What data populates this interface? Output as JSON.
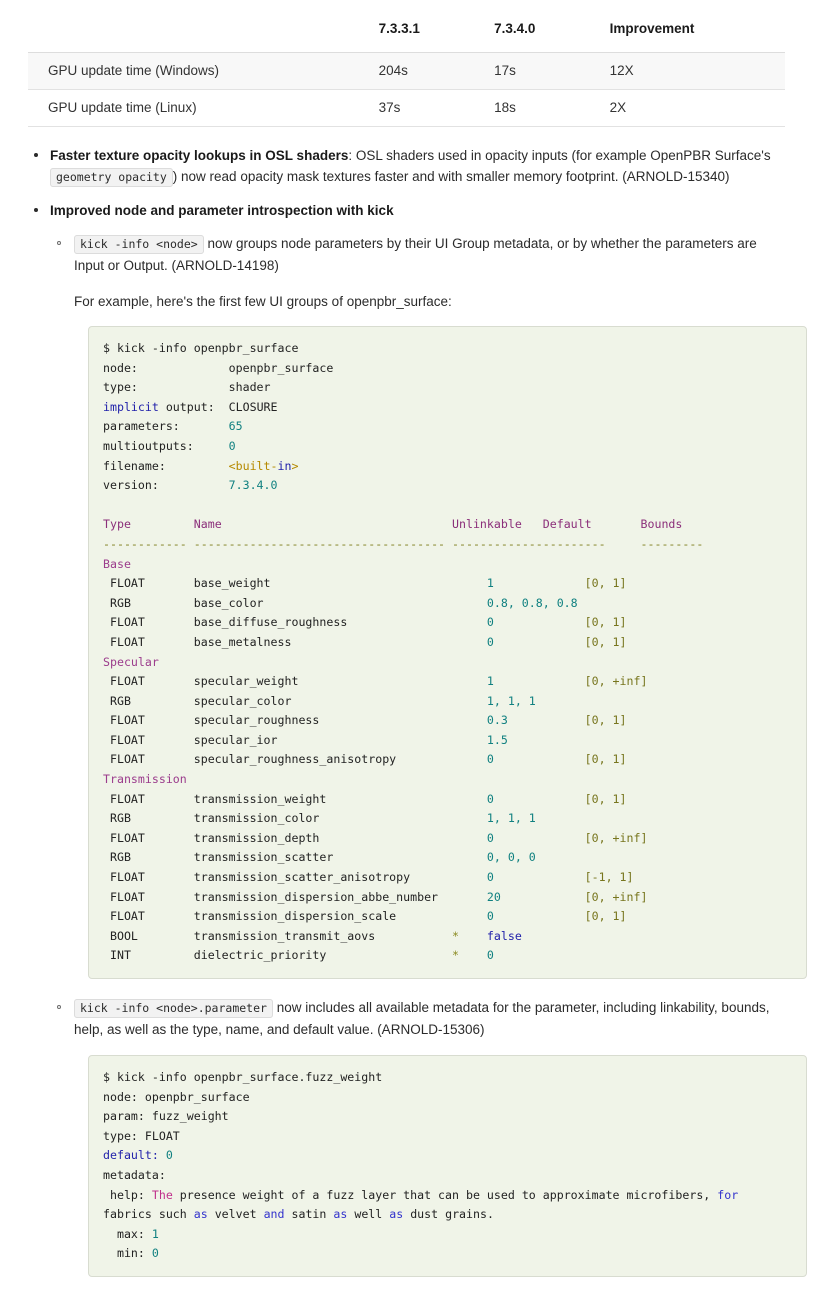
{
  "perf_table": {
    "headers": [
      "",
      "7.3.3.1",
      "7.3.4.0",
      "Improvement"
    ],
    "rows": [
      {
        "label": "GPU update time (Windows)",
        "v1": "204s",
        "v2": "17s",
        "improvement": "12X"
      },
      {
        "label": "GPU update time (Linux)",
        "v1": "37s",
        "v2": "18s",
        "improvement": "2X"
      }
    ]
  },
  "bullets": {
    "item1": {
      "title": "Faster texture opacity lookups in OSL shaders",
      "text_a": ": OSL shaders used in opacity inputs (for example OpenPBR Surface's ",
      "code": "geometry opacity",
      "text_b": ") now read opacity mask textures faster and with smaller memory footprint. (ARNOLD-15340)"
    },
    "item2": {
      "title": "Improved node and parameter introspection with kick",
      "sub1": {
        "code": "kick -info <node>",
        "text": " now groups node parameters by their UI Group metadata, or by whether the parameters are Input or Output. (ARNOLD-14198)",
        "example_intro": "For example, here's the first few UI groups of openpbr_surface:"
      },
      "sub2": {
        "code": "kick -info <node>.parameter",
        "text": " now includes all available metadata for the parameter, including linkability, bounds, help, as well as the type, name, and default value. (ARNOLD-15306)"
      }
    }
  },
  "code_block_1": {
    "command": "$ kick -info openpbr_surface",
    "info_rows": [
      {
        "key": "node:",
        "value": "openpbr_surface",
        "value_kind": "plain"
      },
      {
        "key": "type:",
        "value": "shader",
        "value_kind": "plain"
      },
      {
        "key": "implicit output:",
        "value": "CLOSURE",
        "value_kind": "plain",
        "key_kw": "implicit"
      },
      {
        "key": "parameters:",
        "value": "65",
        "value_kind": "num"
      },
      {
        "key": "multioutputs:",
        "value": "0",
        "value_kind": "num"
      },
      {
        "key": "filename:",
        "value": "<built-in>",
        "value_kind": "builtin"
      },
      {
        "key": "version:",
        "value": "7.3.4.0",
        "value_kind": "num"
      }
    ],
    "table_headers": [
      "Type",
      "Name",
      "Unlinkable",
      "Default",
      "Bounds"
    ],
    "dash_rule": [
      "------------",
      "------------------------------------",
      "-------------",
      "---------"
    ],
    "groups": [
      {
        "name": "Base",
        "params": [
          {
            "type": "FLOAT",
            "name": "base_weight",
            "unlinkable": "",
            "default": "1",
            "default_kind": "num",
            "bounds": "[0, 1]"
          },
          {
            "type": "RGB",
            "name": "base_color",
            "unlinkable": "",
            "default": "0.8, 0.8, 0.8",
            "default_kind": "num",
            "bounds": ""
          },
          {
            "type": "FLOAT",
            "name": "base_diffuse_roughness",
            "unlinkable": "",
            "default": "0",
            "default_kind": "num",
            "bounds": "[0, 1]"
          },
          {
            "type": "FLOAT",
            "name": "base_metalness",
            "unlinkable": "",
            "default": "0",
            "default_kind": "num",
            "bounds": "[0, 1]"
          }
        ]
      },
      {
        "name": "Specular",
        "params": [
          {
            "type": "FLOAT",
            "name": "specular_weight",
            "unlinkable": "",
            "default": "1",
            "default_kind": "num",
            "bounds": "[0, +inf]"
          },
          {
            "type": "RGB",
            "name": "specular_color",
            "unlinkable": "",
            "default": "1, 1, 1",
            "default_kind": "num",
            "bounds": ""
          },
          {
            "type": "FLOAT",
            "name": "specular_roughness",
            "unlinkable": "",
            "default": "0.3",
            "default_kind": "num",
            "bounds": "[0, 1]"
          },
          {
            "type": "FLOAT",
            "name": "specular_ior",
            "unlinkable": "",
            "default": "1.5",
            "default_kind": "num",
            "bounds": ""
          },
          {
            "type": "FLOAT",
            "name": "specular_roughness_anisotropy",
            "unlinkable": "",
            "default": "0",
            "default_kind": "num",
            "bounds": "[0, 1]"
          }
        ]
      },
      {
        "name": "Transmission",
        "params": [
          {
            "type": "FLOAT",
            "name": "transmission_weight",
            "unlinkable": "",
            "default": "0",
            "default_kind": "num",
            "bounds": "[0, 1]"
          },
          {
            "type": "RGB",
            "name": "transmission_color",
            "unlinkable": "",
            "default": "1, 1, 1",
            "default_kind": "num",
            "bounds": ""
          },
          {
            "type": "FLOAT",
            "name": "transmission_depth",
            "unlinkable": "",
            "default": "0",
            "default_kind": "num",
            "bounds": "[0, +inf]"
          },
          {
            "type": "RGB",
            "name": "transmission_scatter",
            "unlinkable": "",
            "default": "0, 0, 0",
            "default_kind": "num",
            "bounds": ""
          },
          {
            "type": "FLOAT",
            "name": "transmission_scatter_anisotropy",
            "unlinkable": "",
            "default": "0",
            "default_kind": "num",
            "bounds": "[-1, 1]"
          },
          {
            "type": "FLOAT",
            "name": "transmission_dispersion_abbe_number",
            "unlinkable": "",
            "default": "20",
            "default_kind": "num",
            "bounds": "[0, +inf]"
          },
          {
            "type": "FLOAT",
            "name": "transmission_dispersion_scale",
            "unlinkable": "",
            "default": "0",
            "default_kind": "num",
            "bounds": "[0, 1]"
          },
          {
            "type": "BOOL",
            "name": "transmission_transmit_aovs",
            "unlinkable": "*",
            "default": "false",
            "default_kind": "kw",
            "bounds": ""
          },
          {
            "type": "INT",
            "name": "dielectric_priority",
            "unlinkable": "*",
            "default": "0",
            "default_kind": "num",
            "bounds": ""
          }
        ]
      }
    ]
  },
  "code_block_2": {
    "command": "$ kick -info openpbr_surface.fuzz_weight",
    "lines": [
      {
        "key": "node:",
        "key_kind": "plain",
        "value": " openpbr_surface"
      },
      {
        "key": "param:",
        "key_kind": "plain",
        "value": " fuzz_weight"
      },
      {
        "key": "type:",
        "key_kind": "plain",
        "value": " FLOAT"
      },
      {
        "key": "default:",
        "key_kind": "kw",
        "value": " 0",
        "value_kind": "num"
      },
      {
        "key": "metadata:",
        "key_kind": "plain",
        "value": ""
      }
    ],
    "help_label": " help:",
    "help_text_parts": [
      {
        "t": " The",
        "c": "magenta"
      },
      {
        "t": " presence weight of a fuzz layer that can be used to approximate microfibers,",
        "c": "plain"
      },
      {
        "t": " for",
        "c": "kw"
      },
      {
        "t": " fabrics such",
        "c": "plain"
      },
      {
        "t": " as",
        "c": "kw"
      },
      {
        "t": " velvet",
        "c": "plain"
      },
      {
        "t": " and",
        "c": "kw"
      },
      {
        "t": " satin",
        "c": "plain"
      },
      {
        "t": " as",
        "c": "kw"
      },
      {
        "t": " well",
        "c": "plain"
      },
      {
        "t": " as",
        "c": "kw"
      },
      {
        "t": " dust grains.",
        "c": "plain"
      }
    ],
    "trailing": [
      {
        "key": "  max:",
        "value": " 1",
        "value_kind": "num"
      },
      {
        "key": "  min:",
        "value": " 0",
        "value_kind": "num"
      }
    ]
  }
}
